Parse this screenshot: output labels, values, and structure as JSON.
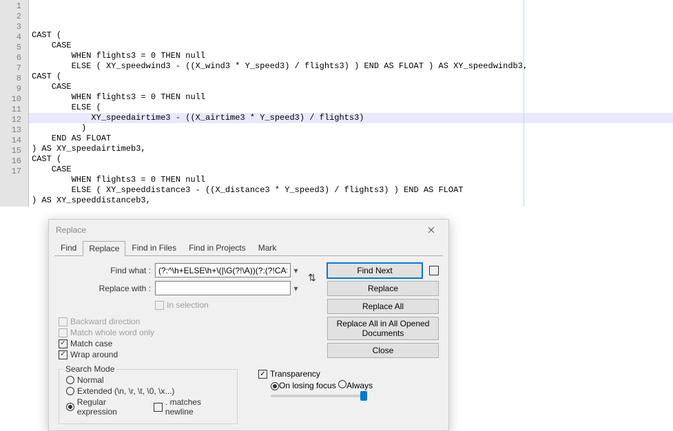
{
  "editor": {
    "lines": [
      "CAST (",
      "    CASE",
      "        WHEN flights3 = 0 THEN null",
      "        ELSE ( XY_speedwind3 - ((X_wind3 * Y_speed3) / flights3) ) END AS FLOAT ) AS XY_speedwindb3,",
      "CAST (",
      "    CASE",
      "        WHEN flights3 = 0 THEN null",
      "        ELSE (",
      "            XY_speedairtime3 - ((X_airtime3 * Y_speed3) / flights3)",
      "          )",
      "    END AS FLOAT",
      ") AS XY_speedairtimeb3,",
      "CAST (",
      "    CASE",
      "        WHEN flights3 = 0 THEN null",
      "        ELSE ( XY_speeddistance3 - ((X_distance3 * Y_speed3) / flights3) ) END AS FLOAT",
      ") AS XY_speeddistanceb3,"
    ],
    "highlight_line": 9
  },
  "dialog": {
    "title": "Replace",
    "tabs": [
      "Find",
      "Replace",
      "Find in Files",
      "Find in Projects",
      "Mark"
    ],
    "active_tab": 1,
    "find_label": "Find what :",
    "find_value": "(?:^\\h+ELSE\\h+\\(|\\G(?!\\A))(?:(?!CAS(?:[ET]))[\\s",
    "replace_label": "Replace with :",
    "replace_value": "",
    "in_selection": "In selection",
    "checks": {
      "backward": "Backward direction",
      "whole": "Match whole word only",
      "matchcase": "Match case",
      "wrap": "Wrap around"
    },
    "search_mode": {
      "title": "Search Mode",
      "normal": "Normal",
      "extended": "Extended (\\n, \\r, \\t, \\0, \\x...)",
      "regex": "Regular expression",
      "dot_newline": ". matches newline"
    },
    "transparency": {
      "title": "Transparency",
      "losing": "On losing focus",
      "always": "Always"
    },
    "buttons": {
      "find_next": "Find Next",
      "replace": "Replace",
      "replace_all": "Replace All",
      "replace_all_docs": "Replace All in All Opened Documents",
      "close": "Close"
    }
  }
}
